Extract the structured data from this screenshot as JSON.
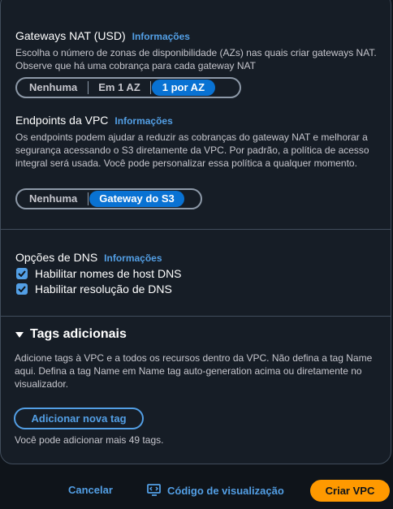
{
  "nat": {
    "title": "Gateways NAT (USD)",
    "info": "Informações",
    "description": "Escolha o número de zonas de disponibilidade (AZs) nas quais criar gateways NAT. Observe que há uma cobrança para cada gateway NAT",
    "options": [
      "Nenhuma",
      "Em 1 AZ",
      "1 por AZ"
    ],
    "selected": "1 por AZ"
  },
  "endpoints": {
    "title": "Endpoints da VPC",
    "info": "Informações",
    "description": "Os endpoints podem ajudar a reduzir as cobranças do gateway NAT e melhorar a segurança acessando o S3 diretamente da VPC. Por padrão, a política de acesso integral será usada. Você pode personalizar essa política a qualquer momento.",
    "options": [
      "Nenhuma",
      "Gateway do S3"
    ],
    "selected": "Gateway do S3"
  },
  "dns": {
    "title": "Opções de DNS",
    "info": "Informações",
    "checkboxes": [
      {
        "label": "Habilitar nomes de host DNS",
        "checked": true
      },
      {
        "label": "Habilitar resolução de DNS",
        "checked": true
      }
    ]
  },
  "tags": {
    "title": "Tags adicionais",
    "expanded": true,
    "description": "Adicione tags à VPC e a todos os recursos dentro da VPC. Não defina a tag Name aqui. Defina a tag Name em Name tag auto-generation acima ou diretamente no visualizador.",
    "add_button": "Adicionar nova tag",
    "hint": "Você pode adicionar mais 49 tags."
  },
  "footer": {
    "cancel": "Cancelar",
    "code_preview": "Código de visualização",
    "create": "Criar VPC"
  },
  "colors": {
    "background": "#0f141a",
    "panel": "#161d26",
    "link": "#539fe5",
    "selected_segment": "#0972d3",
    "primary_button": "#ff9900"
  },
  "icons": {
    "expand": "caret-down-icon",
    "checkbox": "checkmark-icon",
    "code_preview": "code-preview-icon"
  }
}
